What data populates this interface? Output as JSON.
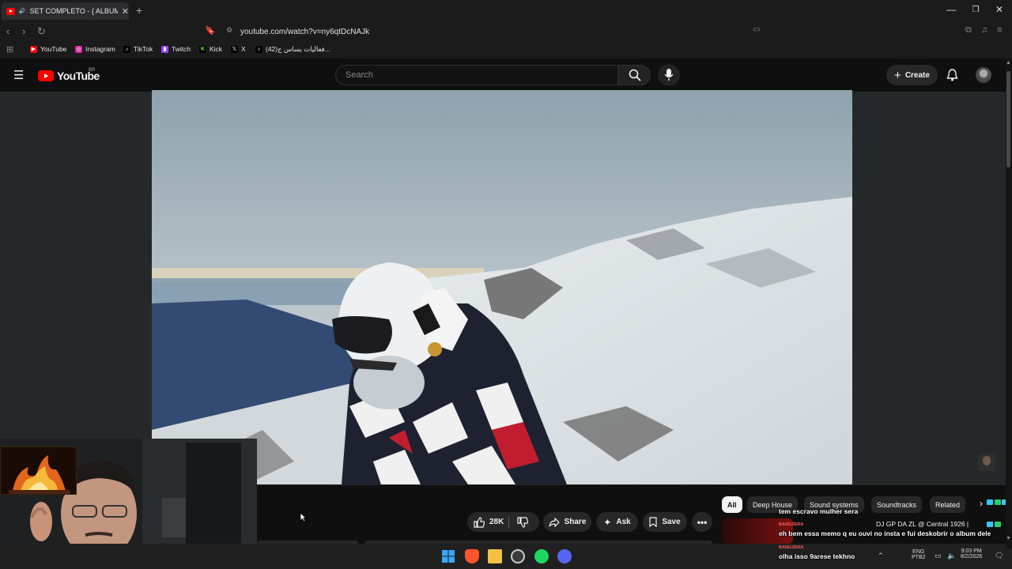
{
  "browser": {
    "tab_title": "SET COMPLETO - { ALBUM M...",
    "url": "youtube.com/watch?v=ny6qtDcNAJk",
    "bookmarks": [
      {
        "label": "YouTube",
        "icon": "youtube-icon",
        "color": "#ff0000"
      },
      {
        "label": "Instagram",
        "icon": "instagram-icon",
        "color": "#d6249f"
      },
      {
        "label": "TikTok",
        "icon": "tiktok-icon",
        "color": "#000000"
      },
      {
        "label": "Twitch",
        "icon": "twitch-icon",
        "color": "#9146ff"
      },
      {
        "label": "Kick",
        "icon": "kick-icon",
        "color": "#53fc18"
      },
      {
        "label": "X",
        "icon": "x-icon",
        "color": "#000000"
      },
      {
        "label": "(42)فعاليات بساس ج...",
        "icon": "tiktok-icon",
        "color": "#000000"
      }
    ]
  },
  "youtube": {
    "logo_text": "YouTube",
    "country_code": "BR",
    "search_placeholder": "Search",
    "create_label": "Create",
    "likes": "28K",
    "share_label": "Share",
    "ask_label": "Ask",
    "save_label": "Save",
    "chips": [
      "All",
      "Deep House",
      "Sound systems",
      "Soundtracks",
      "Related"
    ],
    "active_chip": "All",
    "related_title": "DJ GP DA ZL @ Central 1926 |"
  },
  "chat_overlay": [
    {
      "user": "",
      "message": "tem escravo mulher sera"
    },
    {
      "user": "BANGZERA",
      "message": "eh bem essa memo q eu ouvi no insta e fui deskobrir o album dele"
    },
    {
      "user": "BANGZERA",
      "message": "olha isso 9arese tekhno"
    }
  ],
  "taskbar": {
    "lang_top": "ENG",
    "lang_bottom": "PTB2",
    "time": "9:03 PM",
    "date": "8/2/2026"
  },
  "colors": {
    "yt_red": "#ff0000",
    "background": "#0f0f0f",
    "button": "#272727"
  }
}
